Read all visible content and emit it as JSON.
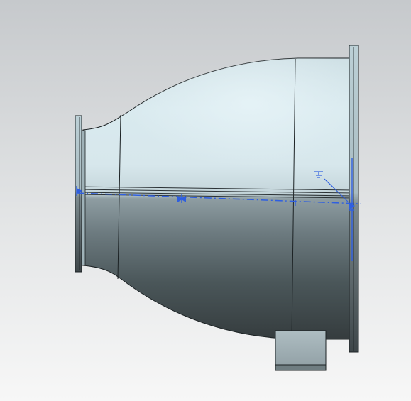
{
  "viewport": {
    "view_mode": "shaded-with-edges",
    "model": "pipe-reducer-with-flanges",
    "annotations": {
      "dimension_color": "#2f5fe0",
      "ground_symbol_icon": "ground-symbol-icon"
    }
  },
  "colors": {
    "background_top": "#c6c9cc",
    "background_bottom": "#f7f7f7",
    "body_highlight": "#e2eff3",
    "body_shadow": "#34393b",
    "edge_line": "#1c2224"
  }
}
